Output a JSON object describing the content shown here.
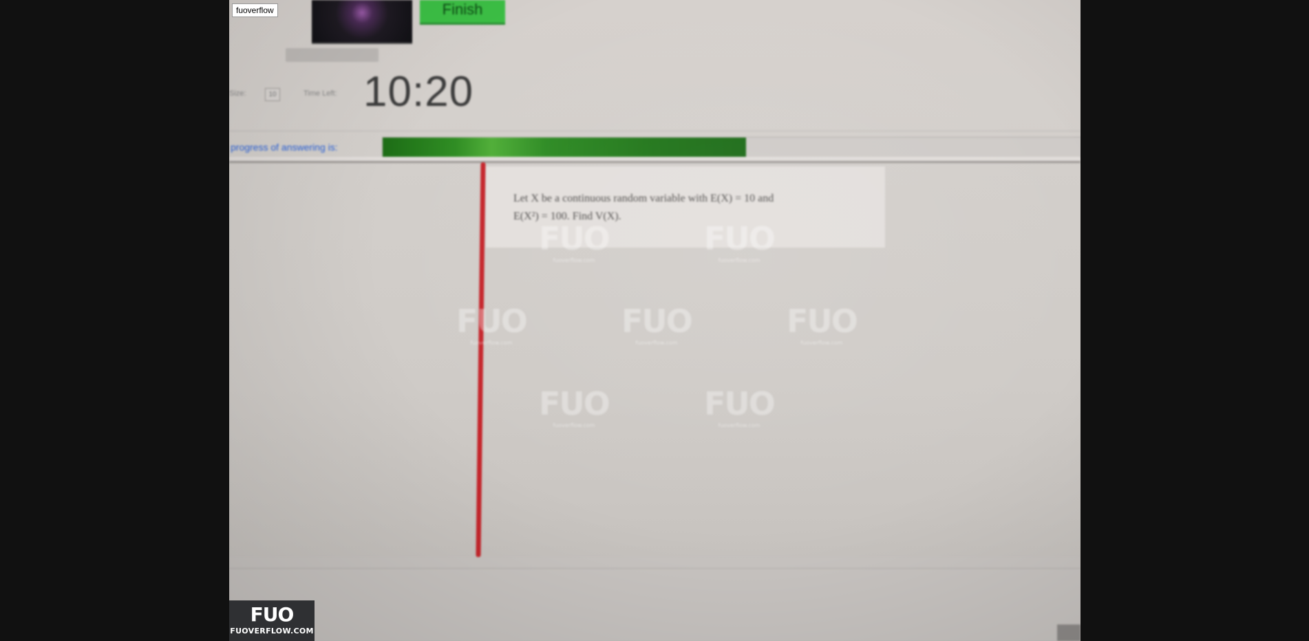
{
  "source_tag": "fuoverflow",
  "header": {
    "user_lines": [
      "",
      "",
      ""
    ],
    "finish_label": "Finish",
    "small_button_label": "",
    "controls": {
      "size_label": "Size:",
      "size_value": "10",
      "time_left_label": "Time Left:",
      "time_left": "10:20"
    }
  },
  "progress": {
    "label": "progress of answering is:",
    "fraction": 0.52
  },
  "question": {
    "line1": "Let X be a continuous random variable with E(X) = 10 and",
    "line2": "E(X²) = 100. Find V(X)."
  },
  "watermarks": {
    "mark": "FUO",
    "caption": "fuoverflow.com"
  },
  "logo": {
    "mark": "FUO",
    "url": "FUOVERFLOW.COM"
  },
  "colors": {
    "finish": "#3cbf45",
    "progress": "#2e8c22",
    "rule": "#c5242a",
    "link": "#2b62d9"
  }
}
